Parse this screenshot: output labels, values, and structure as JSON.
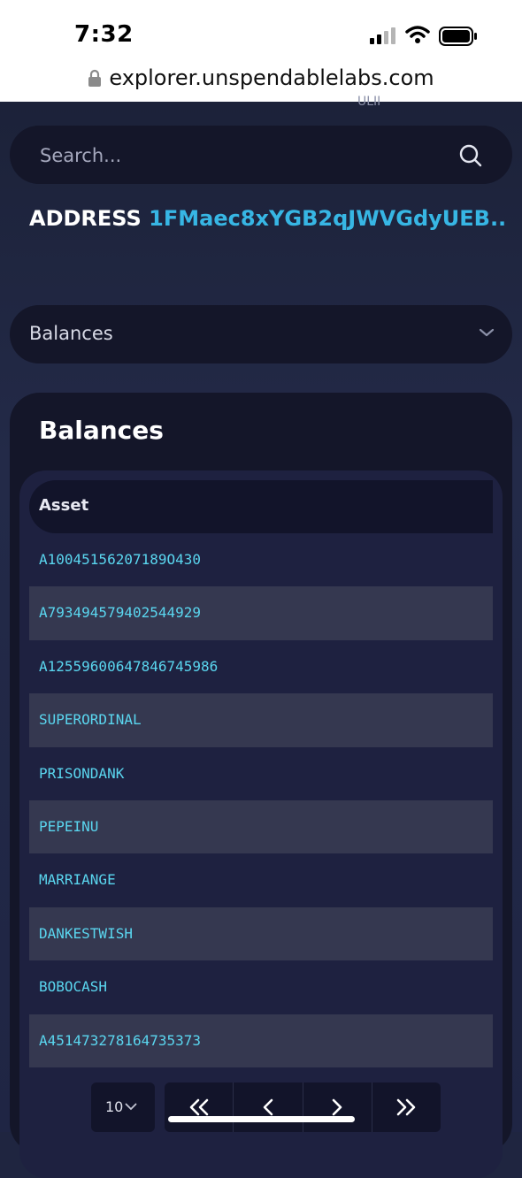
{
  "status_bar": {
    "time": "7:32"
  },
  "browser": {
    "url": "explorer.unspendablelabs.com"
  },
  "header": {
    "peek_text": "ULII"
  },
  "search": {
    "placeholder": "Search..."
  },
  "address": {
    "label": "ADDRESS",
    "value": "1FMaec8xYGB2qJWVGdyUEB..."
  },
  "section_select": {
    "selected": "Balances"
  },
  "balances": {
    "title": "Balances",
    "column_header": "Asset",
    "rows": [
      "A10045156207189O430",
      "A793494579402544929",
      "A12559600647846745986",
      "SUPERORDINAL",
      "PRISONDANK",
      "PEPEINU",
      "MARRIANGE",
      "DANKESTWISH",
      "BOBOCASH",
      "A451473278164735373"
    ]
  },
  "pagination": {
    "page_size": "10",
    "first_icon": "double-chevron-left-icon",
    "prev_icon": "chevron-left-icon",
    "next_icon": "chevron-right-icon",
    "last_icon": "double-chevron-right-icon"
  },
  "colors": {
    "accent": "#37b6e4",
    "asset_text": "#5ad6ef",
    "card_bg": "#141629",
    "row_alt": "#353850"
  }
}
